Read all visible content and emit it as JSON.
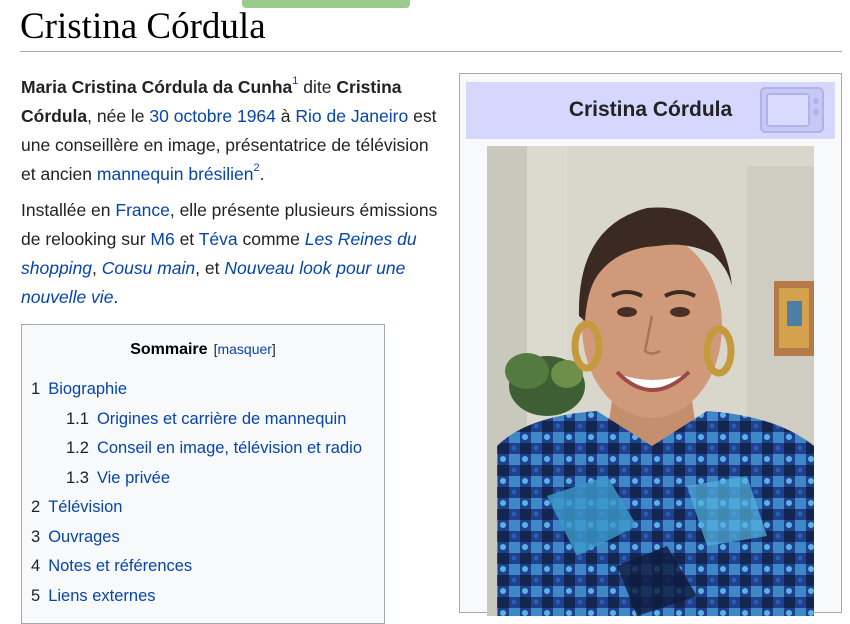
{
  "page": {
    "title": "Cristina Córdula"
  },
  "intro": {
    "p1": {
      "name_full": "Maria Cristina Córdula da Cunha",
      "ref1": "1",
      "t_dite": " dite ",
      "name_short": "Cristina Córdula",
      "t_nee": ", née le ",
      "link_date": "30 octobre 1964",
      "t_a": " à ",
      "link_city": "Rio de Janeiro",
      "t_desc": " est une conseillère en image, présentatrice de télévision et ancien ",
      "link_model": "mannequin brésilien",
      "ref2": "2",
      "t_end": "."
    },
    "p2": {
      "t_start": "Installée en ",
      "link_france": "France",
      "t_mid": ", elle présente plusieurs émissions de relooking sur ",
      "link_m6": "M6",
      "t_et": " et ",
      "link_teva": "Téva",
      "t_comme": " comme ",
      "link_show1": "Les Reines du shopping",
      "t_comma": ", ",
      "link_show2": "Cousu main",
      "t_et2": ", et ",
      "link_show3": "Nouveau look pour une nouvelle vie",
      "t_end": "."
    }
  },
  "toc": {
    "title": "Sommaire",
    "bracket_open": "[",
    "toggle": "masquer",
    "bracket_close": "]",
    "items": [
      {
        "num": "1",
        "label": "Biographie"
      },
      {
        "num": "1.1",
        "label": "Origines et carrière de mannequin"
      },
      {
        "num": "1.2",
        "label": "Conseil en image, télévision et radio"
      },
      {
        "num": "1.3",
        "label": "Vie privée"
      },
      {
        "num": "2",
        "label": "Télévision"
      },
      {
        "num": "3",
        "label": "Ouvrages"
      },
      {
        "num": "4",
        "label": "Notes et références"
      },
      {
        "num": "5",
        "label": "Liens externes"
      }
    ]
  },
  "infobox": {
    "title": "Cristina Córdula",
    "icon": "television-icon",
    "title_band_color": "#d5d7ff"
  },
  "colors": {
    "link": "#0645ad",
    "text": "#222222",
    "border": "#a2a9b1",
    "accent_tab": "#9cc98e"
  }
}
